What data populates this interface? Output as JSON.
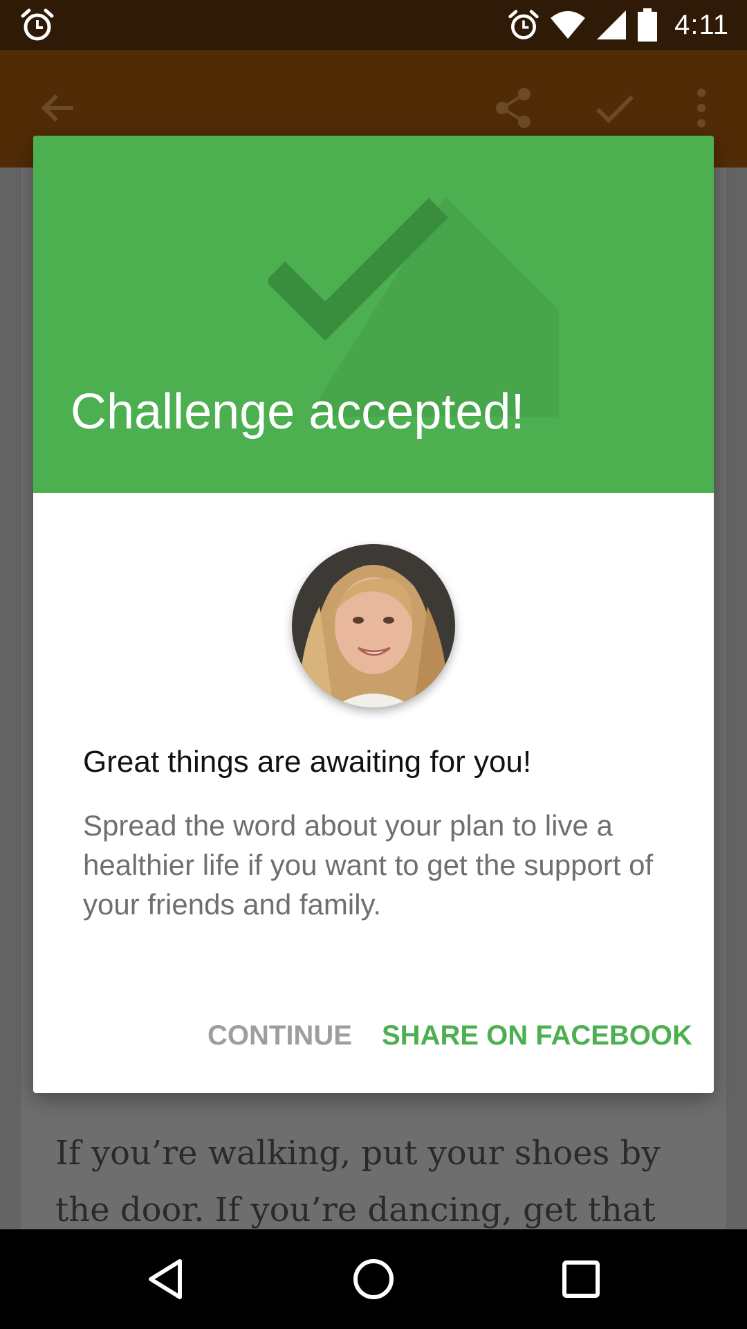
{
  "status_bar": {
    "time": "4:11",
    "icons": [
      "alarm-icon",
      "alarm-icon",
      "wifi-icon",
      "signal-icon",
      "battery-icon"
    ]
  },
  "app_bar": {
    "icons": [
      "back-arrow-icon",
      "share-icon",
      "check-icon",
      "more-vert-icon"
    ]
  },
  "dialog": {
    "title": "Challenge accepted!",
    "message_title": "Great things are awaiting for you!",
    "message_body": "Spread the word about your plan to live a healthier life if you want to get the support of your friends and family.",
    "buttons": {
      "continue": "CONTINUE",
      "share": "SHARE ON FACEBOOK"
    }
  },
  "background_article": {
    "text": "If you’re walking, put your shoes by the door. If you’re dancing, get that"
  },
  "nav_bar": {
    "icons": [
      "back-triangle-icon",
      "home-circle-icon",
      "recents-square-icon"
    ]
  },
  "colors": {
    "accent_green": "#4caf50",
    "status_bar": "#2e1a06",
    "app_bar": "#512b06",
    "scrim": "#646464"
  }
}
